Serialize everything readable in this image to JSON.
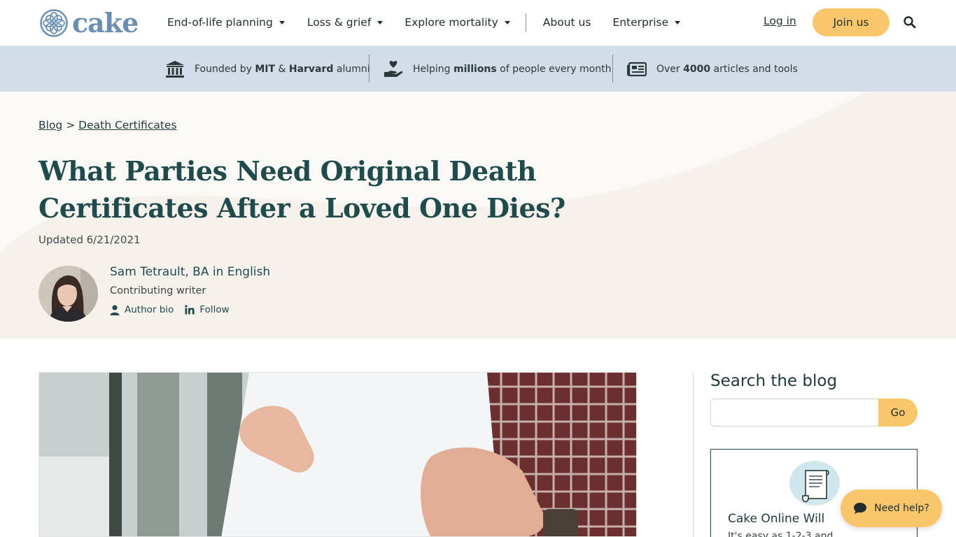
{
  "header": {
    "logo_text": "cake",
    "nav": [
      {
        "label": "End-of-life planning"
      },
      {
        "label": "Loss & grief"
      },
      {
        "label": "Explore mortality"
      },
      {
        "label": "About us"
      },
      {
        "label": "Enterprise"
      }
    ],
    "login_label": "Log in",
    "join_label": "Join us",
    "accent_color": "#f9c66b",
    "brand_color": "#6a8fb3"
  },
  "trust": {
    "item1": {
      "pre": "Founded by ",
      "b1": "MIT",
      "mid": " & ",
      "b2": "Harvard",
      "post": " alumni",
      "icon": "institution-icon"
    },
    "item2": {
      "pre": "Helping ",
      "b1": "millions",
      "post": " of people every month",
      "icon": "heart-hand-icon"
    },
    "item3": {
      "pre": "Over ",
      "b1": "4000",
      "post": " articles and tools",
      "icon": "newspaper-icon"
    }
  },
  "article": {
    "breadcrumb": {
      "blog": "Blog",
      "sep": ">",
      "category": "Death Certificates"
    },
    "title": "What Parties Need Original Death Certificates After a Loved One Dies?",
    "updated": "Updated 6/21/2021",
    "author": {
      "name": "Sam Tetrault, BA in English",
      "role": "Contributing writer",
      "bio_label": "Author bio",
      "follow_label": "Follow"
    }
  },
  "sidebar": {
    "search_title": "Search the blog",
    "search_value": "",
    "go_label": "Go",
    "card": {
      "title": "Cake Online Will",
      "subtitle": "It's easy as 1-2-3 and"
    }
  },
  "help": {
    "label": "Need help?"
  }
}
